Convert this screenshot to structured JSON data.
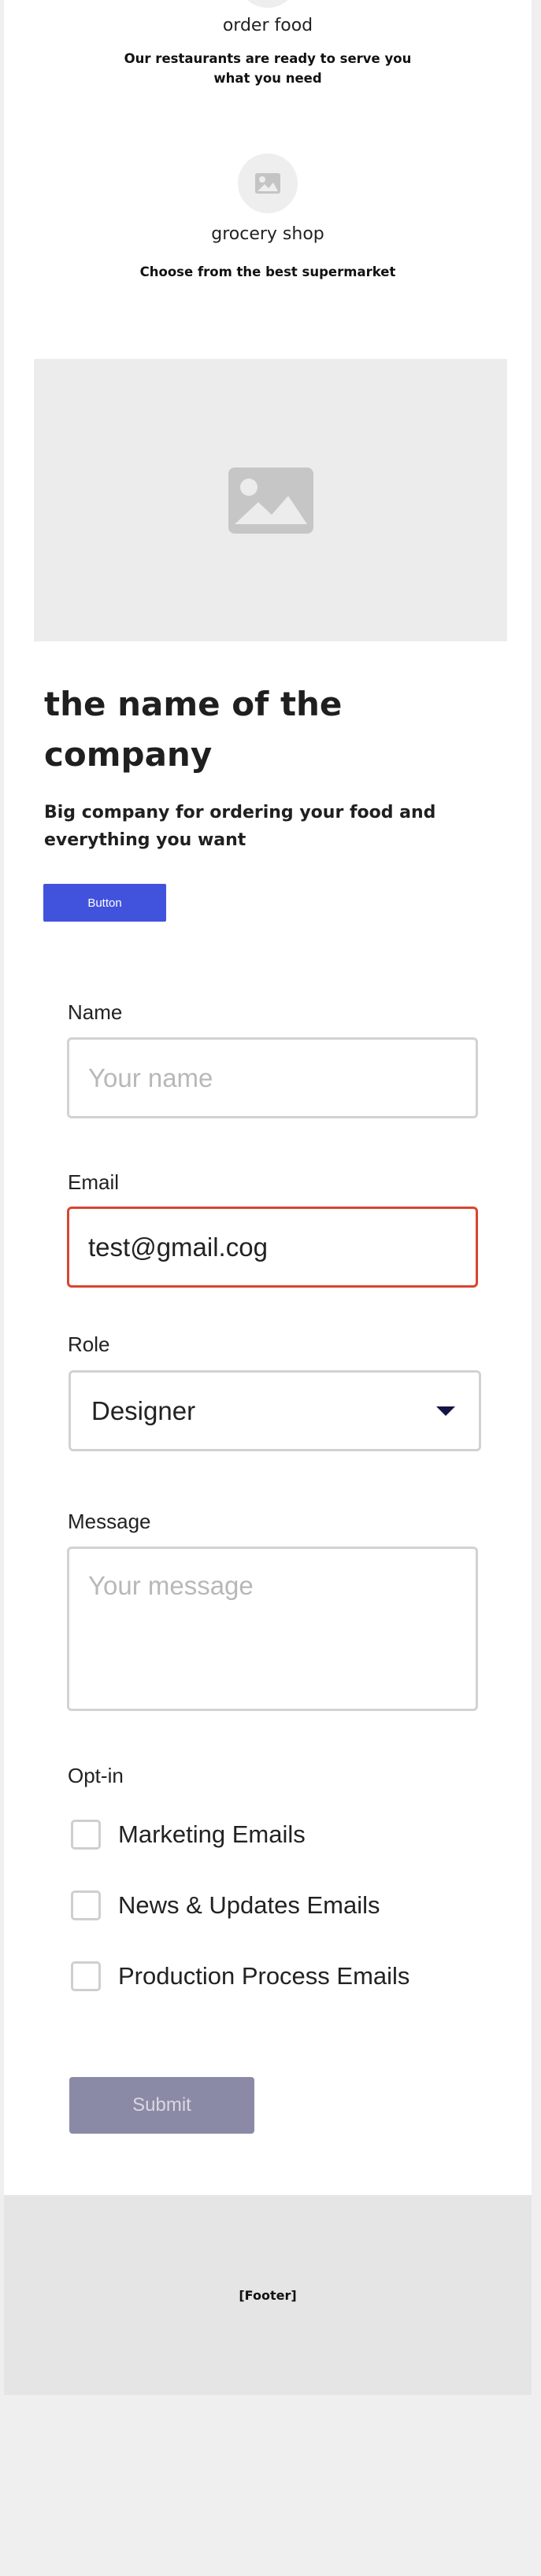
{
  "features": [
    {
      "title": "order food",
      "desc_line1": "Our restaurants are ready to serve you",
      "desc_line2": "what you need",
      "icon": "image-icon"
    },
    {
      "title": "grocery shop",
      "desc": "Choose from the best supermarket",
      "icon": "image-icon"
    }
  ],
  "hero": {
    "icon": "image-placeholder-icon"
  },
  "company": {
    "title_line1": "the name of the",
    "title_line2": "company",
    "subtitle_line1": "Big company for ordering your food and",
    "subtitle_line2": "everything you want",
    "button_label": "Button"
  },
  "form": {
    "name": {
      "label": "Name",
      "placeholder": "Your name",
      "value": ""
    },
    "email": {
      "label": "Email",
      "value": "test@gmail.cog",
      "state": "error",
      "error_color": "#d9452e"
    },
    "role": {
      "label": "Role",
      "selected": "Designer"
    },
    "message": {
      "label": "Message",
      "placeholder": "Your message"
    },
    "optin": {
      "label": "Opt-in",
      "options": [
        {
          "label": "Marketing Emails",
          "checked": false
        },
        {
          "label": "News & Updates Emails",
          "checked": false
        },
        {
          "label": "Production Process Emails",
          "checked": false
        }
      ]
    },
    "submit_label": "Submit"
  },
  "footer": {
    "text": "[Footer]"
  },
  "colors": {
    "accent": "#4153dd",
    "submit_disabled": "#8b8aa6",
    "footer_bg": "#e5e5e5",
    "page_bg": "#efefef"
  }
}
